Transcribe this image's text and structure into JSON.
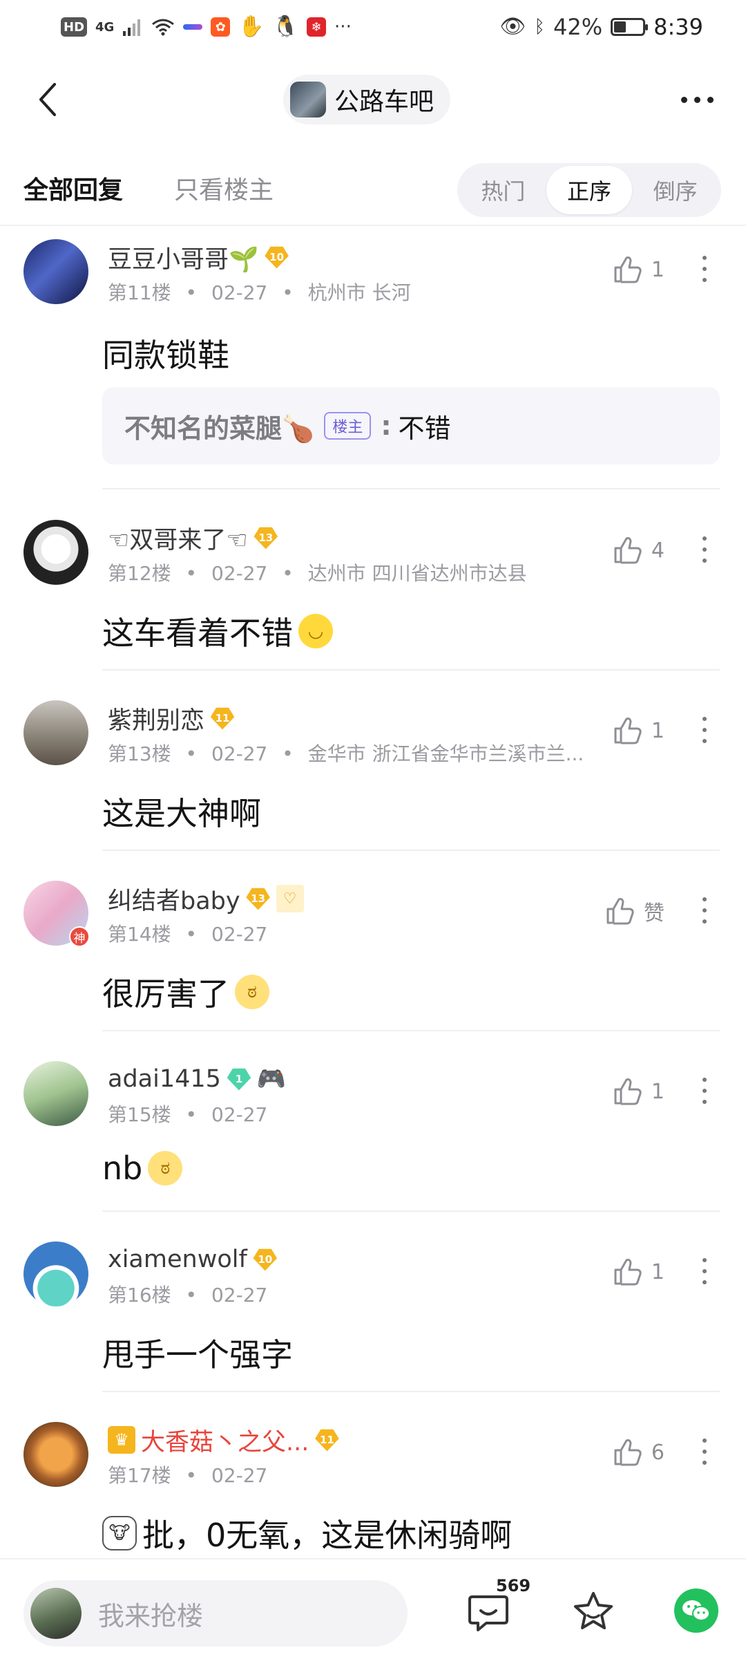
{
  "status_bar": {
    "hd": "HD",
    "network": "4G",
    "app_icons": [
      "app-icon-1",
      "app-icon-2",
      "app-icon-3",
      "app-icon-4"
    ],
    "more": "···",
    "battery": "42%",
    "battery_level": 0.42,
    "time": "8:39"
  },
  "header": {
    "forum_name": "公路车吧"
  },
  "tabs": {
    "all": "全部回复",
    "op_only": "只看楼主",
    "sort": [
      "热门",
      "正序",
      "倒序"
    ],
    "active_sort": "正序"
  },
  "replies": [
    {
      "username": "豆豆小哥哥🌱",
      "level": "10",
      "floor": "第11楼",
      "date": "02-27",
      "location": "杭州市 长河",
      "likes": "1",
      "content": "同款锁鞋",
      "sub_reply": {
        "name": "不知名的菜腿🍗",
        "op_tag": "楼主",
        "colon": ":",
        "text": "不错"
      }
    },
    {
      "username": "☜双哥来了☜",
      "level": "13",
      "floor": "第12楼",
      "date": "02-27",
      "location": "达州市 四川省达州市达县",
      "likes": "4",
      "content": "这车看着不错"
    },
    {
      "username": "紫荆别恋",
      "level": "11",
      "floor": "第13楼",
      "date": "02-27",
      "location": "金华市 浙江省金华市兰溪市兰...",
      "likes": "1",
      "content": "这是大神啊"
    },
    {
      "username": "纠结者baby",
      "level": "13",
      "floor": "第14楼",
      "date": "02-27",
      "location": "",
      "likes": "赞",
      "content": "很厉害了",
      "avatar_badge": "神"
    },
    {
      "username": "adai1415",
      "level": "1",
      "floor": "第15楼",
      "date": "02-27",
      "location": "",
      "likes": "1",
      "content": "nb"
    },
    {
      "username": "xiamenwolf",
      "level": "10",
      "floor": "第16楼",
      "date": "02-27",
      "location": "",
      "likes": "1",
      "content": "甩手一个强字"
    },
    {
      "username": "大香菇丶之父...",
      "level": "11",
      "floor": "第17楼",
      "date": "02-27",
      "location": "",
      "likes": "6",
      "content": "批，0无氧，这是休闲骑啊"
    }
  ],
  "meta_sep": "•",
  "bottom_bar": {
    "placeholder": "我来抢楼",
    "comment_count": "569"
  },
  "colors": {
    "accent_gold": "#f5b51e",
    "level_green": "#4cd4a9",
    "vip_red": "#e8453c",
    "op_tag_purple": "#6b5fd6",
    "wechat_green": "#22c15e"
  }
}
